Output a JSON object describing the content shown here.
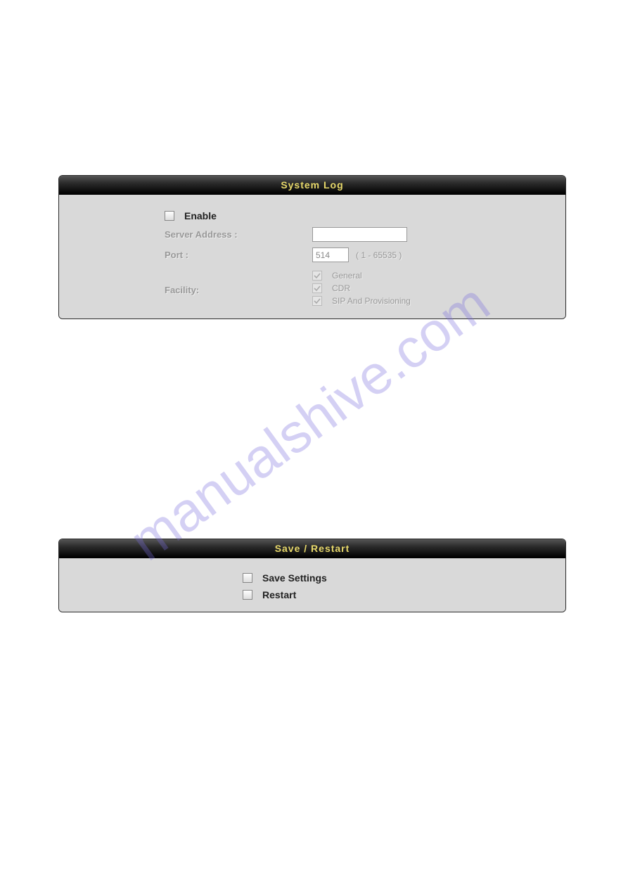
{
  "watermark": "manualshive.com",
  "syslog": {
    "title": "System Log",
    "enable_label": "Enable",
    "enable_checked": false,
    "server_label": "Server Address :",
    "server_value": "",
    "port_label": "Port :",
    "port_value": "514",
    "port_hint": "( 1 - 65535 )",
    "facility_label": "Facility:",
    "facility_items": [
      {
        "label": "General",
        "checked": true
      },
      {
        "label": "CDR",
        "checked": true
      },
      {
        "label": "SIP And Provisioning",
        "checked": true
      }
    ]
  },
  "save": {
    "title": "Save / Restart",
    "items": [
      {
        "label": "Save Settings",
        "checked": false
      },
      {
        "label": "Restart",
        "checked": false
      }
    ]
  }
}
